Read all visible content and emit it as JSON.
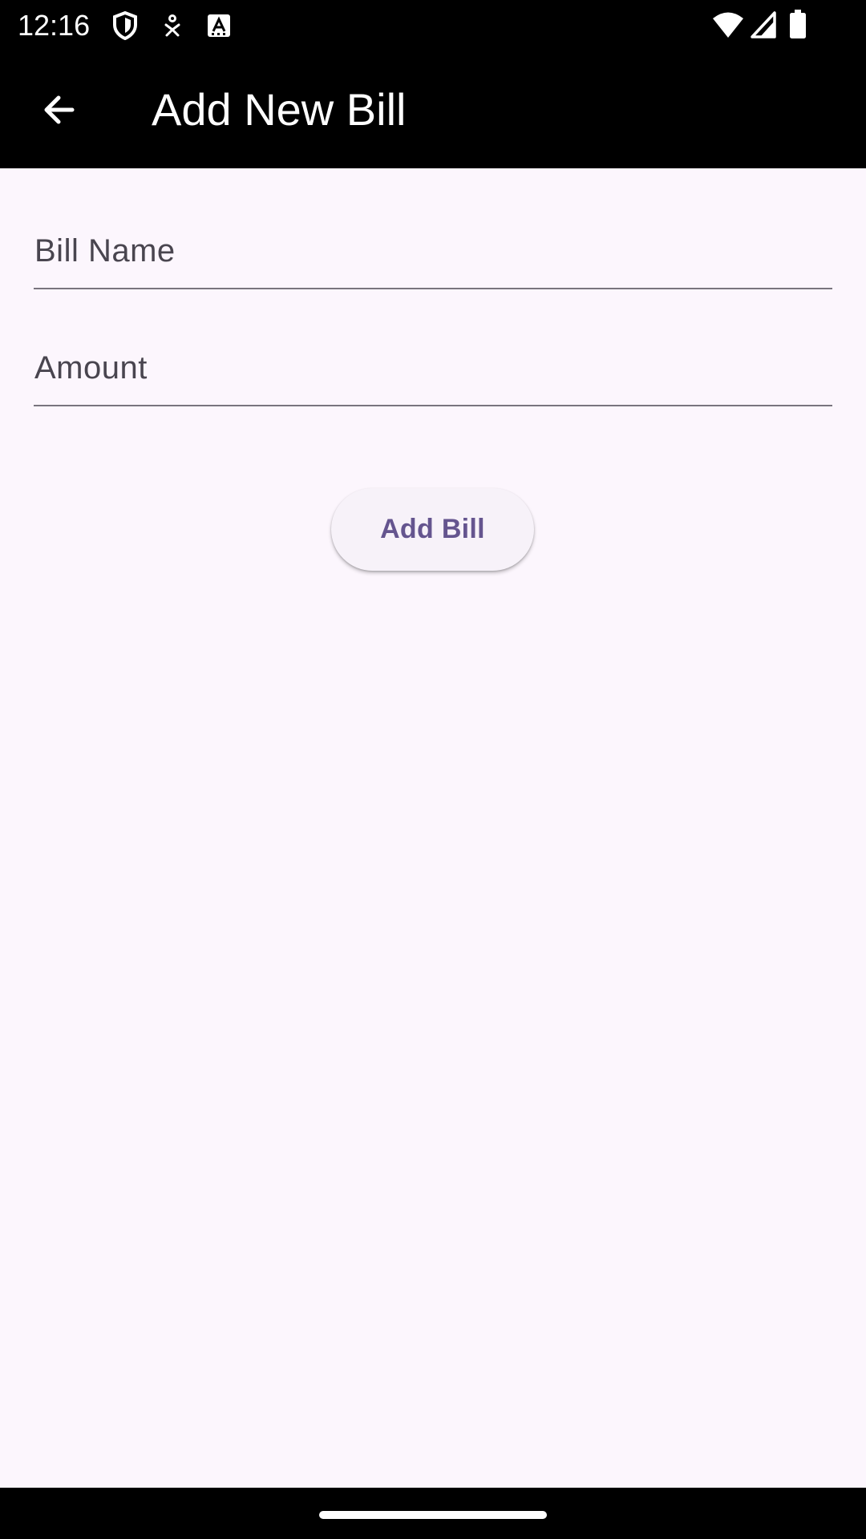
{
  "status_bar": {
    "time": "12:16",
    "left_icons": [
      "shield-icon",
      "accessibility-icon",
      "keyboard-a-icon"
    ],
    "right_icons": [
      "wifi-icon",
      "signal-icon",
      "battery-icon"
    ]
  },
  "app_bar": {
    "back_icon": "arrow-back-icon",
    "title": "Add New Bill"
  },
  "form": {
    "bill_name": {
      "label": "Bill Name",
      "value": ""
    },
    "amount": {
      "label": "Amount",
      "value": ""
    },
    "submit_label": "Add Bill"
  },
  "colors": {
    "background": "#fcf6fd",
    "bar": "#000000",
    "accent": "#65558f",
    "button_surface": "#f7f2f9",
    "field_underline": "#79747e",
    "label_text": "#49454f"
  }
}
